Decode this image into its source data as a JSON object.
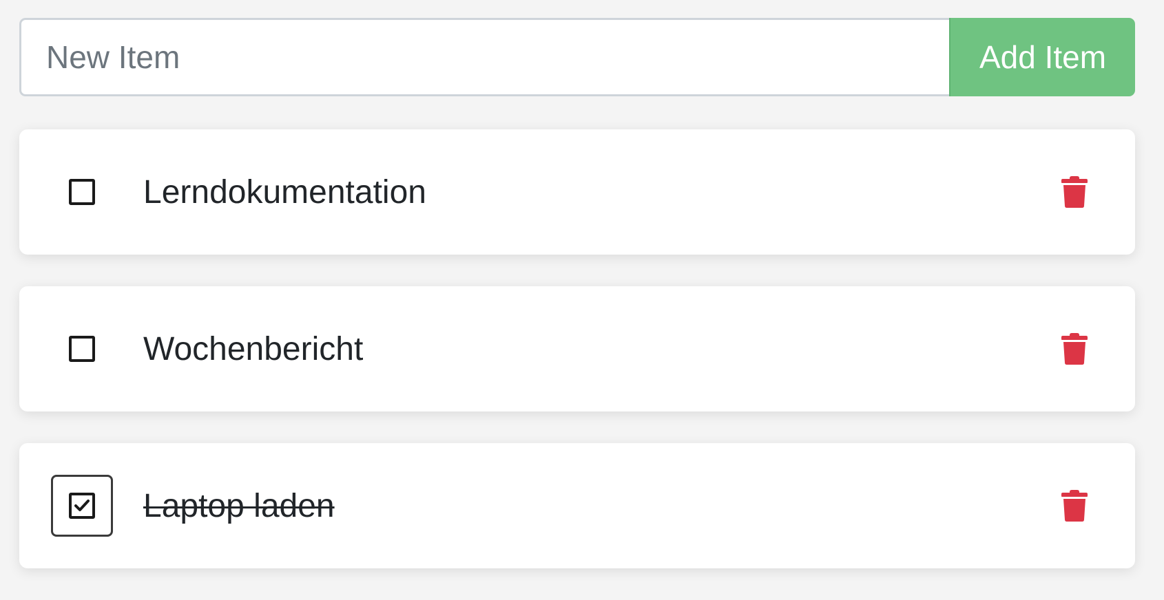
{
  "add_form": {
    "input_value": "",
    "input_placeholder": "New Item",
    "button_label": "Add Item"
  },
  "colors": {
    "add_button": "#6fc381",
    "delete_icon": "#dc3545",
    "page_background": "#f4f4f4"
  },
  "items": [
    {
      "label": "Lerndokumentation",
      "checked": false,
      "icon_checkbox": "square-icon",
      "icon_delete": "trash-icon"
    },
    {
      "label": "Wochenbericht",
      "checked": false,
      "icon_checkbox": "square-icon",
      "icon_delete": "trash-icon"
    },
    {
      "label": "Laptop laden",
      "checked": true,
      "icon_checkbox": "check-square-icon",
      "icon_delete": "trash-icon"
    }
  ]
}
